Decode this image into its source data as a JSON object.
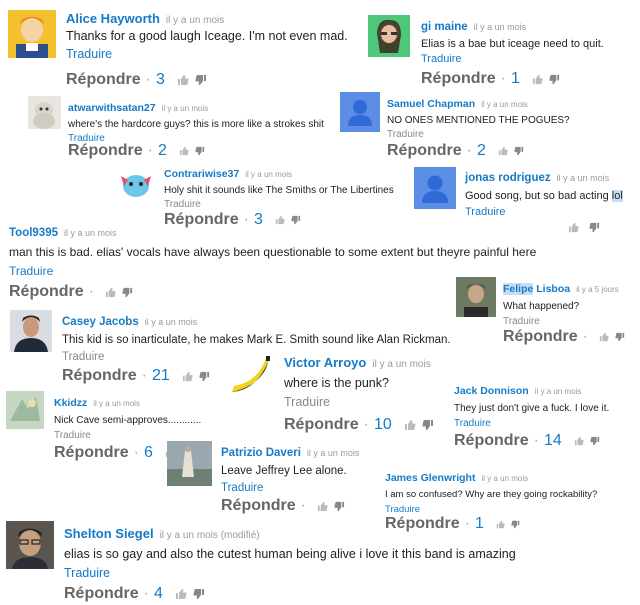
{
  "labels": {
    "translate": "Traduire",
    "reply": "Répondre"
  },
  "comments": {
    "alice": {
      "name": "Alice Hayworth",
      "time": "il y a un mois",
      "text": "Thanks for a good laugh Iceage. I'm not even mad.",
      "likes": "3"
    },
    "gi": {
      "name": "gi maine",
      "time": "il y a un mois",
      "text": "Elias is a bae but iceage need to quit.",
      "likes": "1"
    },
    "atwar": {
      "name": "atwarwithsatan27",
      "time": "il y a un mois",
      "text": "where's the hardcore guys? this is more like a strokes shit",
      "likes": "2"
    },
    "samuel": {
      "name": "Samuel Chapman",
      "time": "il y a un mois",
      "text": "NO ONES MENTIONED THE POGUES?",
      "likes": "2"
    },
    "contrariwise": {
      "name": "Contrariwise37",
      "time": "il y a un mois",
      "text": "Holy shit it sounds like The Smiths or The Libertines",
      "likes": "3"
    },
    "jonas": {
      "name": "jonas rodriguez",
      "time": "il y a un mois",
      "text_before": "Good song, but so bad acting ",
      "text_highlight": "lol"
    },
    "tool": {
      "name": "Tool9395",
      "time": "il y a un mois",
      "text": "man this is bad. elias' vocals have always been questionable to some extent but theyre painful here"
    },
    "felipe": {
      "name_first": "Felipe",
      "name_last": " Lisboa",
      "time": "il y a 5 jours",
      "text": "What happened?"
    },
    "casey": {
      "name": "Casey Jacobs",
      "time": "il y a un mois",
      "text": "This kid is so inarticulate, he makes Mark E. Smith sound like Alan Rickman.",
      "likes": "21"
    },
    "victor": {
      "name": "Victor Arroyo",
      "time": "il y a un mois",
      "text": "where is the punk?",
      "likes": "10"
    },
    "jack": {
      "name": "Jack Donnison",
      "time": "il y a un mois",
      "text": "They just don't give a fuck. I love it.",
      "likes": "14"
    },
    "kkidzz": {
      "name": "Kkidzz",
      "time": "il y a un mois",
      "text": "Nick Cave semi-approves............",
      "likes": "6"
    },
    "patrizio": {
      "name": "Patrizio Daveri",
      "time": "il y a un mois",
      "text": "Leave Jeffrey Lee alone."
    },
    "james": {
      "name": "James Glenwright",
      "time": "il y a un mois",
      "text": "I am so confused? Why are they going rockability?",
      "likes": "1"
    },
    "shelton": {
      "name": "Shelton Siegel",
      "time": "il y a un mois (modifié)",
      "text": "elias is so gay and also the cutest human being alive i love it this band is amazing",
      "likes": "4"
    }
  },
  "icons": {
    "like": "thumbs-up-icon",
    "dislike": "thumbs-down-icon"
  },
  "colors": {
    "link": "#167ac6",
    "timestamp": "#999999",
    "placeholder_avatar": "#5c8ee6"
  }
}
